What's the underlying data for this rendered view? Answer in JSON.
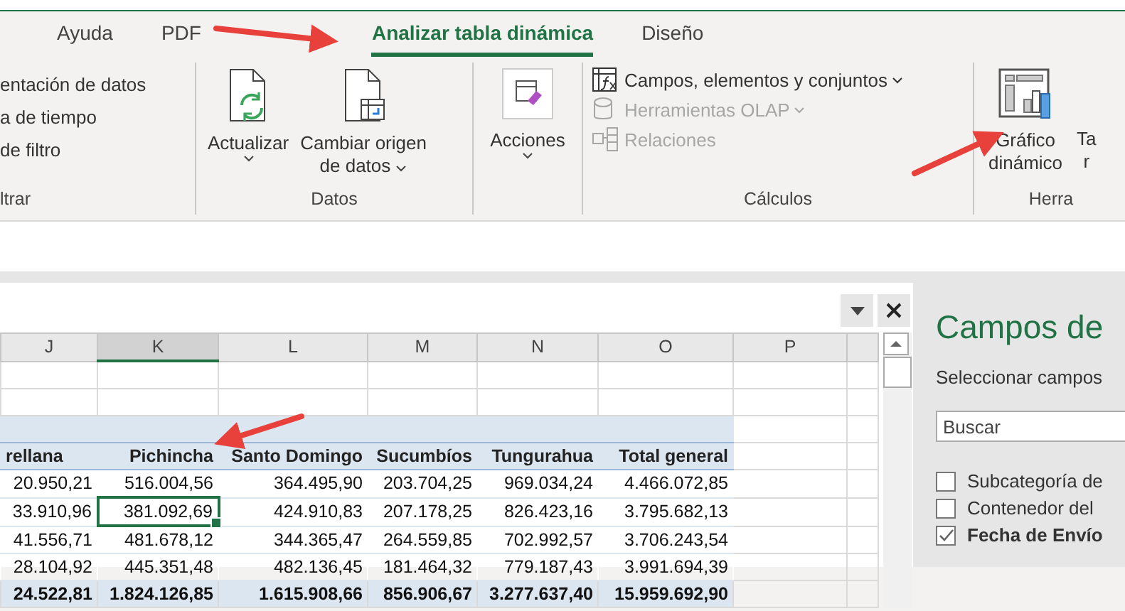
{
  "tabs": [
    {
      "label": "Ayuda",
      "selected": false
    },
    {
      "label": "PDF",
      "selected": false
    },
    {
      "label": "Analizar tabla dinámica",
      "selected": true
    },
    {
      "label": "Diseño",
      "selected": false
    }
  ],
  "ribbon": {
    "filter_group": {
      "items": [
        "entación de datos",
        "a de tiempo",
        "de filtro"
      ],
      "label": "ltrar"
    },
    "datos_group": {
      "buttons": [
        {
          "label": "Actualizar",
          "kind": "refresh"
        },
        {
          "label": "Cambiar origen",
          "label2": "de datos",
          "kind": "source"
        }
      ],
      "label": "Datos"
    },
    "acciones": {
      "label": "Acciones"
    },
    "calculos_group": {
      "items": [
        {
          "label": "Campos, elementos y conjuntos",
          "disabled": false,
          "kind": "fields"
        },
        {
          "label": "Herramientas OLAP",
          "disabled": true,
          "kind": "olap"
        },
        {
          "label": "Relaciones",
          "disabled": true,
          "kind": "relations"
        }
      ],
      "label": "Cálculos"
    },
    "tools_group": {
      "chart_button": {
        "label": "Gráfico",
        "label2": "dinámico"
      },
      "cut_button": {
        "label": "Ta",
        "label2": "r"
      },
      "label": "Herra"
    }
  },
  "sheet": {
    "columns": [
      {
        "letter": "J",
        "selected": false
      },
      {
        "letter": "K",
        "selected": true
      },
      {
        "letter": "L",
        "selected": false
      },
      {
        "letter": "M",
        "selected": false
      },
      {
        "letter": "N",
        "selected": false
      },
      {
        "letter": "O",
        "selected": false
      },
      {
        "letter": "P",
        "selected": false
      }
    ],
    "pivot_headers": [
      "rellana",
      "Pichincha",
      "Santo Domingo",
      "Sucumbíos",
      "Tungurahua",
      "Total general"
    ],
    "rows": [
      {
        "kind": "data",
        "cells": [
          {
            "text": "20.950,21",
            "selected": false
          },
          {
            "text": "516.004,56",
            "selected": false
          },
          {
            "text": "364.495,90",
            "selected": false
          },
          {
            "text": "203.704,25",
            "selected": false
          },
          {
            "text": "969.034,24",
            "selected": false
          },
          {
            "text": "4.466.072,85",
            "selected": false
          }
        ]
      },
      {
        "kind": "data",
        "cells": [
          {
            "text": "33.910,96",
            "selected": false
          },
          {
            "text": "381.092,69",
            "selected": true
          },
          {
            "text": "424.910,83",
            "selected": false
          },
          {
            "text": "207.178,25",
            "selected": false
          },
          {
            "text": "826.423,16",
            "selected": false
          },
          {
            "text": "3.795.682,13",
            "selected": false
          }
        ]
      },
      {
        "kind": "data",
        "cells": [
          {
            "text": "41.556,71",
            "selected": false
          },
          {
            "text": "481.678,12",
            "selected": false
          },
          {
            "text": "344.365,47",
            "selected": false
          },
          {
            "text": "264.559,85",
            "selected": false
          },
          {
            "text": "702.992,57",
            "selected": false
          },
          {
            "text": "3.706.243,54",
            "selected": false
          }
        ]
      },
      {
        "kind": "data",
        "cells": [
          {
            "text": "28.104,92",
            "selected": false
          },
          {
            "text": "445.351,48",
            "selected": false
          },
          {
            "text": "482.136,45",
            "selected": false
          },
          {
            "text": "181.464,32",
            "selected": false
          },
          {
            "text": "779.187,43",
            "selected": false
          },
          {
            "text": "3.991.694,39",
            "selected": false
          }
        ]
      },
      {
        "kind": "total",
        "cells": [
          {
            "text": "24.522,81",
            "selected": false
          },
          {
            "text": "1.824.126,85",
            "selected": false
          },
          {
            "text": "1.615.908,66",
            "selected": false
          },
          {
            "text": "856.906,67",
            "selected": false
          },
          {
            "text": "3.277.637,40",
            "selected": false
          },
          {
            "text": "15.959.692,90",
            "selected": false
          }
        ]
      }
    ]
  },
  "pane": {
    "title": "Campos de",
    "subtitle": "Seleccionar campos",
    "search": {
      "placeholder": "Buscar"
    },
    "fields": [
      {
        "label": "Subcategoría de",
        "checked": false
      },
      {
        "label": "Contenedor del",
        "checked": false
      },
      {
        "label": "Fecha de Envío",
        "checked": true
      }
    ]
  }
}
